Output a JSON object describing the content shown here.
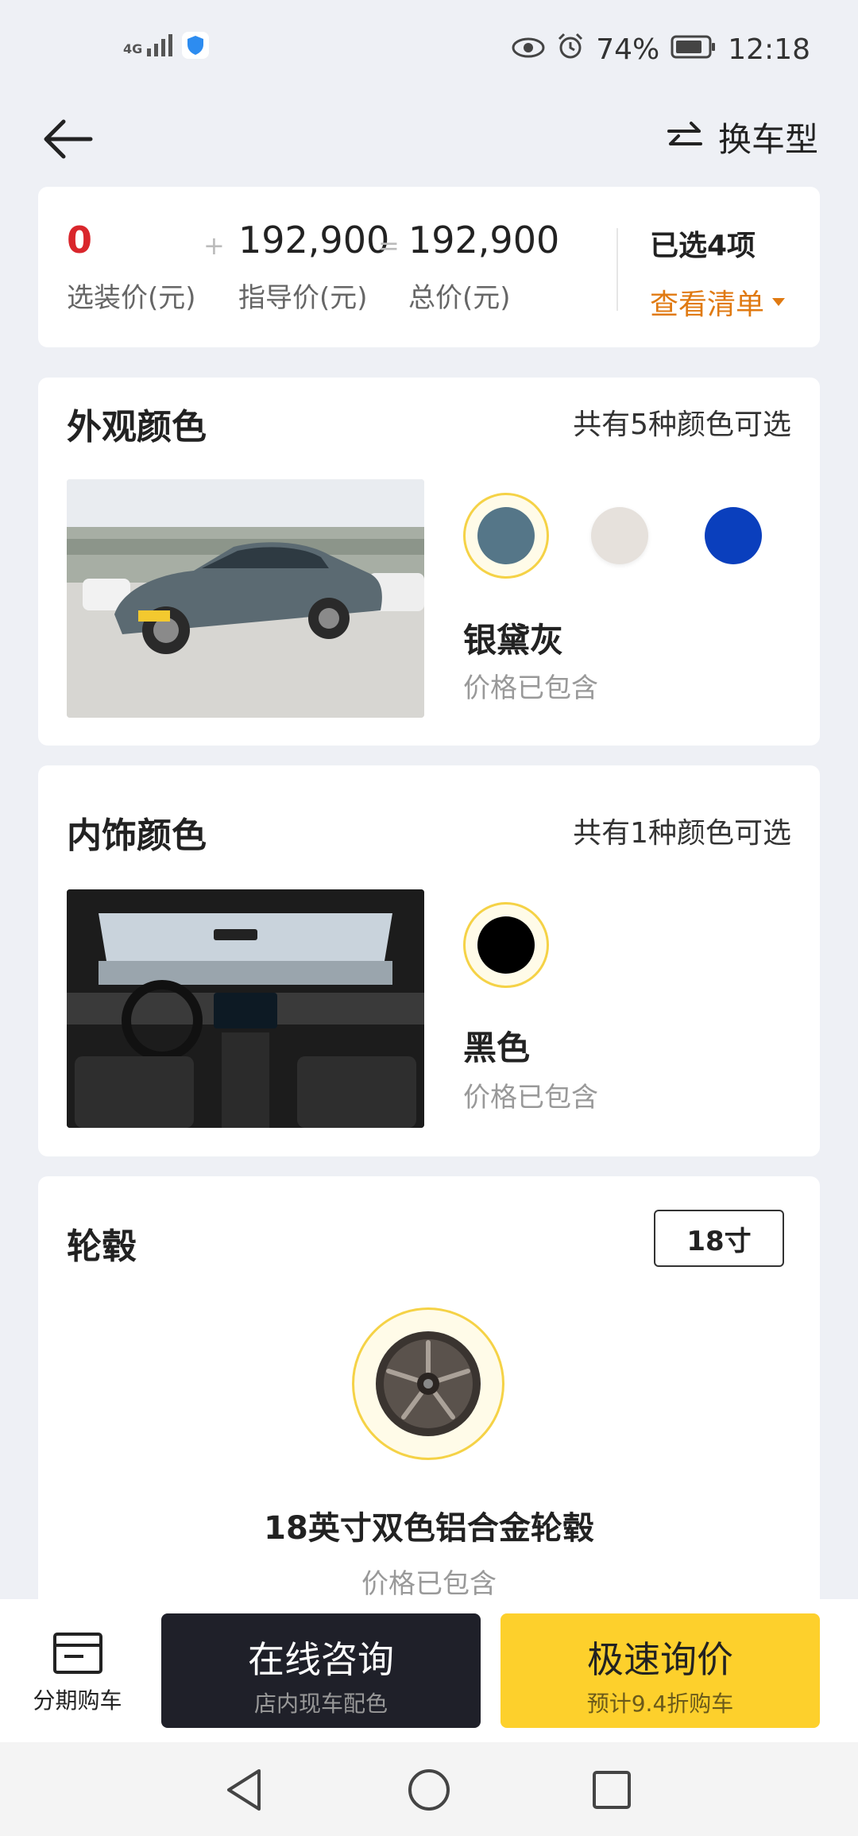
{
  "status_bar": {
    "network": "4G",
    "battery": "74%",
    "time": "12:18"
  },
  "header": {
    "switch_label": "换车型"
  },
  "price_summary": {
    "option_price": "0",
    "option_price_label": "选装价(元)",
    "plus": "+",
    "guide_price": "192,900",
    "guide_price_label": "指导价(元)",
    "equals": "=",
    "total_price": "192,900",
    "total_price_label": "总价(元)",
    "selected_count": "已选4项",
    "view_list": "查看清单",
    "colors": {
      "option_price": "#d9262c",
      "view_list": "#e07a12"
    }
  },
  "exterior": {
    "title": "外观颜色",
    "count": "共有5种颜色可选",
    "swatches": [
      {
        "name": "银黛灰",
        "color": "#557688",
        "selected": true
      },
      {
        "color": "#e6e1dc",
        "selected": false
      },
      {
        "color": "#0a3fbd",
        "selected": false
      }
    ],
    "selected_name": "银黛灰",
    "price_note": "价格已包含"
  },
  "interior": {
    "title": "内饰颜色",
    "count": "共有1种颜色可选",
    "swatches": [
      {
        "name": "黑色",
        "color": "#000000",
        "selected": true
      }
    ],
    "selected_name": "黑色",
    "price_note": "价格已包含"
  },
  "wheels": {
    "title": "轮毂",
    "size_tag": "18寸",
    "name": "18英寸双色铝合金轮毂",
    "price_note": "价格已包含"
  },
  "bottom_bar": {
    "installment": "分期购车",
    "consult_title": "在线咨询",
    "consult_sub": "店内现车配色",
    "quote_title": "极速询价",
    "quote_sub": "预计9.4折购车",
    "colors": {
      "consult_bg": "#1f2029",
      "quote_bg": "#fdd02c"
    }
  }
}
